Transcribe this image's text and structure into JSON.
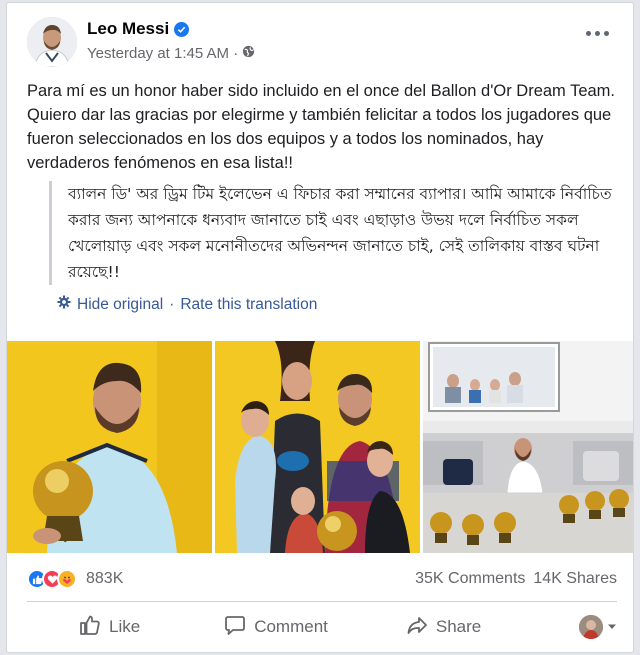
{
  "post": {
    "author": "Leo Messi",
    "timestamp": "Yesterday at 1:45 AM ·",
    "text": "Para mí es un honor haber sido incluido en el once del Ballon d'Or Dream Team. Quiero dar las gracias por elegirme y también felicitar a todos los jugadores que fueron seleccionados en los dos equipos y a todos los nominados, hay verdaderos fenómenos en esa lista!!",
    "translation": "ব্যালন ডি' অর ড্রিম টিম ইলেভেন এ ফিচার করা সম্মানের ব্যাপার। আমি আমাকে নির্বাচিত করার জন্য আপনাকে ধন্যবাদ জানাতে চাই এবং এছাড়াও উভয় দলে নির্বাচিত সকল খেলোয়াড় এবং সকল মনোনীতদের অভিনন্দন জানাতে চাই, সেই তালিকায় বাস্তব ঘটনা রয়েছে!!",
    "hide_original": "Hide original",
    "separator": "·",
    "rate_translation": "Rate this translation"
  },
  "stats": {
    "reactions_count": "883K",
    "comments": "35K Comments",
    "shares": "14K Shares"
  },
  "actions": {
    "like": "Like",
    "comment": "Comment",
    "share": "Share"
  },
  "icons": {
    "verified": "verified-badge-icon",
    "privacy": "globe-icon",
    "translate": "gear-icon",
    "reactions": [
      "like-reaction-icon",
      "love-reaction-icon",
      "care-reaction-icon"
    ]
  },
  "colors": {
    "link": "#385898",
    "accent": "#1877f2",
    "muted": "#65676b"
  }
}
